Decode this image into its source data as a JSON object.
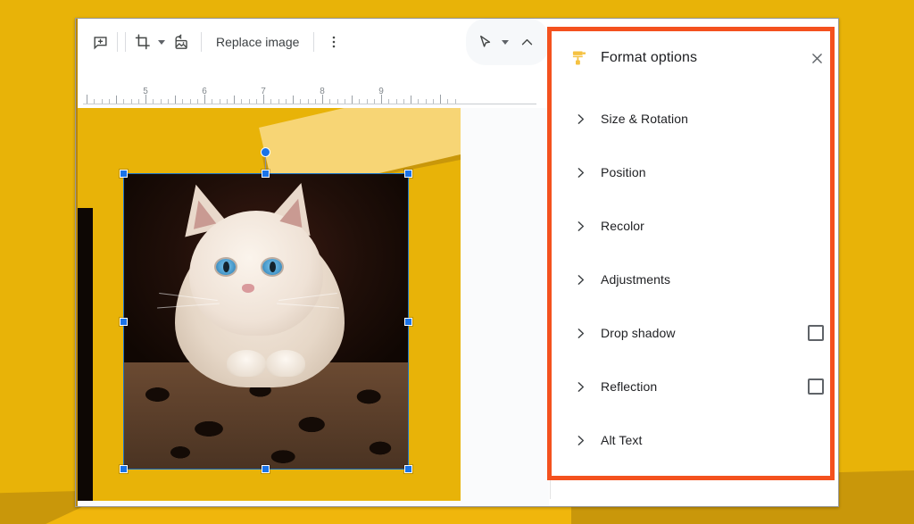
{
  "colors": {
    "slide_yellow": "#E8B308",
    "page_background": "#E8B308",
    "highlight_orange": "#F4511E",
    "selection_blue": "#1a73e8",
    "panel_background": "#FFFFFF",
    "roller_icon_yellow": "#F5C242"
  },
  "toolbar": {
    "comment_icon": "add-comment-icon",
    "crop_icon": "crop-icon",
    "crop_dropdown": "chevron-down-icon",
    "mask_icon": "image-mask-icon",
    "replace_image_label": "Replace image",
    "more_options_icon": "more-vertical-icon",
    "select_cursor_icon": "cursor-arrow-icon",
    "select_dropdown": "chevron-down-icon",
    "collapse_icon": "chevron-up-icon"
  },
  "ruler": {
    "unit": "in",
    "labels": [
      "5",
      "6",
      "7",
      "8",
      "9"
    ],
    "label_positions": [
      70,
      136,
      202,
      268,
      334
    ]
  },
  "slide": {
    "background_color": "#E8B308",
    "selected_object": "image",
    "selection_handles": 8,
    "rotation_handle": true
  },
  "panel": {
    "icon": "paint-roller-icon",
    "title": "Format options",
    "close_icon": "close-icon",
    "options": [
      {
        "label": "Size & Rotation",
        "expand_icon": "chevron-right-icon",
        "has_checkbox": false,
        "checked": false
      },
      {
        "label": "Position",
        "expand_icon": "chevron-right-icon",
        "has_checkbox": false,
        "checked": false
      },
      {
        "label": "Recolor",
        "expand_icon": "chevron-right-icon",
        "has_checkbox": false,
        "checked": false
      },
      {
        "label": "Adjustments",
        "expand_icon": "chevron-right-icon",
        "has_checkbox": false,
        "checked": false
      },
      {
        "label": "Drop shadow",
        "expand_icon": "chevron-right-icon",
        "has_checkbox": true,
        "checked": false
      },
      {
        "label": "Reflection",
        "expand_icon": "chevron-right-icon",
        "has_checkbox": true,
        "checked": false
      },
      {
        "label": "Alt Text",
        "expand_icon": "chevron-right-icon",
        "has_checkbox": false,
        "checked": false
      }
    ]
  },
  "highlight": {
    "name": "format-options-highlight",
    "color": "#F4511E"
  }
}
